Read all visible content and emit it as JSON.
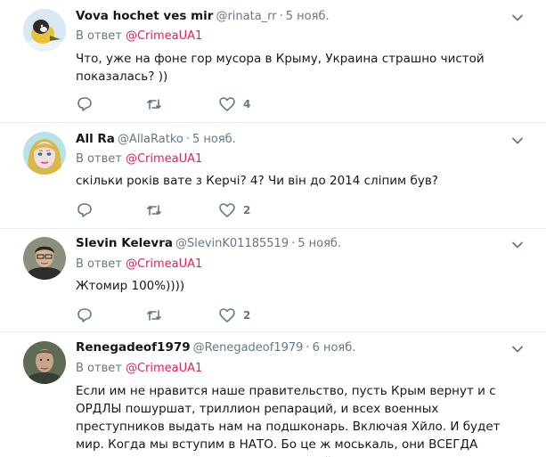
{
  "tweets": [
    {
      "name": "Vova hochet ves mir",
      "handle": "@rinata_rr",
      "dot": "·",
      "time": "5 нояб.",
      "reply_prefix": "В ответ",
      "reply_to": "@CrimeaUA1",
      "text": "Что, уже на фоне гор мусора в Крыму, Украина страшно чистой показалась? ))",
      "likes": "4"
    },
    {
      "name": "All Ra",
      "handle": "@AllaRatko",
      "dot": "·",
      "time": "5 нояб.",
      "reply_prefix": "В ответ",
      "reply_to": "@CrimeaUA1",
      "text": "скільки років вате з Керчі? 4? Чи він до 2014 сліпим був?",
      "likes": "2"
    },
    {
      "name": "Slevin Kelevra",
      "handle": "@SlevinK01185519",
      "dot": "·",
      "time": "5 нояб.",
      "reply_prefix": "В ответ",
      "reply_to": "@CrimeaUA1",
      "text": "Жтомир 100%))))",
      "likes": "2"
    },
    {
      "name": "Renegadeof1979",
      "handle": "@Renegadeof1979",
      "dot": "·",
      "time": "6 нояб.",
      "reply_prefix": "В ответ",
      "reply_to": "@CrimeaUA1",
      "text": "Если им не нравится наше правительство, пусть Крым вернут и с ОРДЛЫ пошуршат, триллион репараций, и всех военных преступников выдать нам на подшконарь. Включая Хйло. И будет мир. Когда мы вступим в НАТО. Бо це ж моськаль, они ВСЕГДА возвращаются, как созданные нами сайлоны"
    }
  ],
  "colors": {
    "name": "#14171a",
    "meta": "#657786",
    "mention": "#e0245e",
    "separator": "#e6ecf0"
  }
}
